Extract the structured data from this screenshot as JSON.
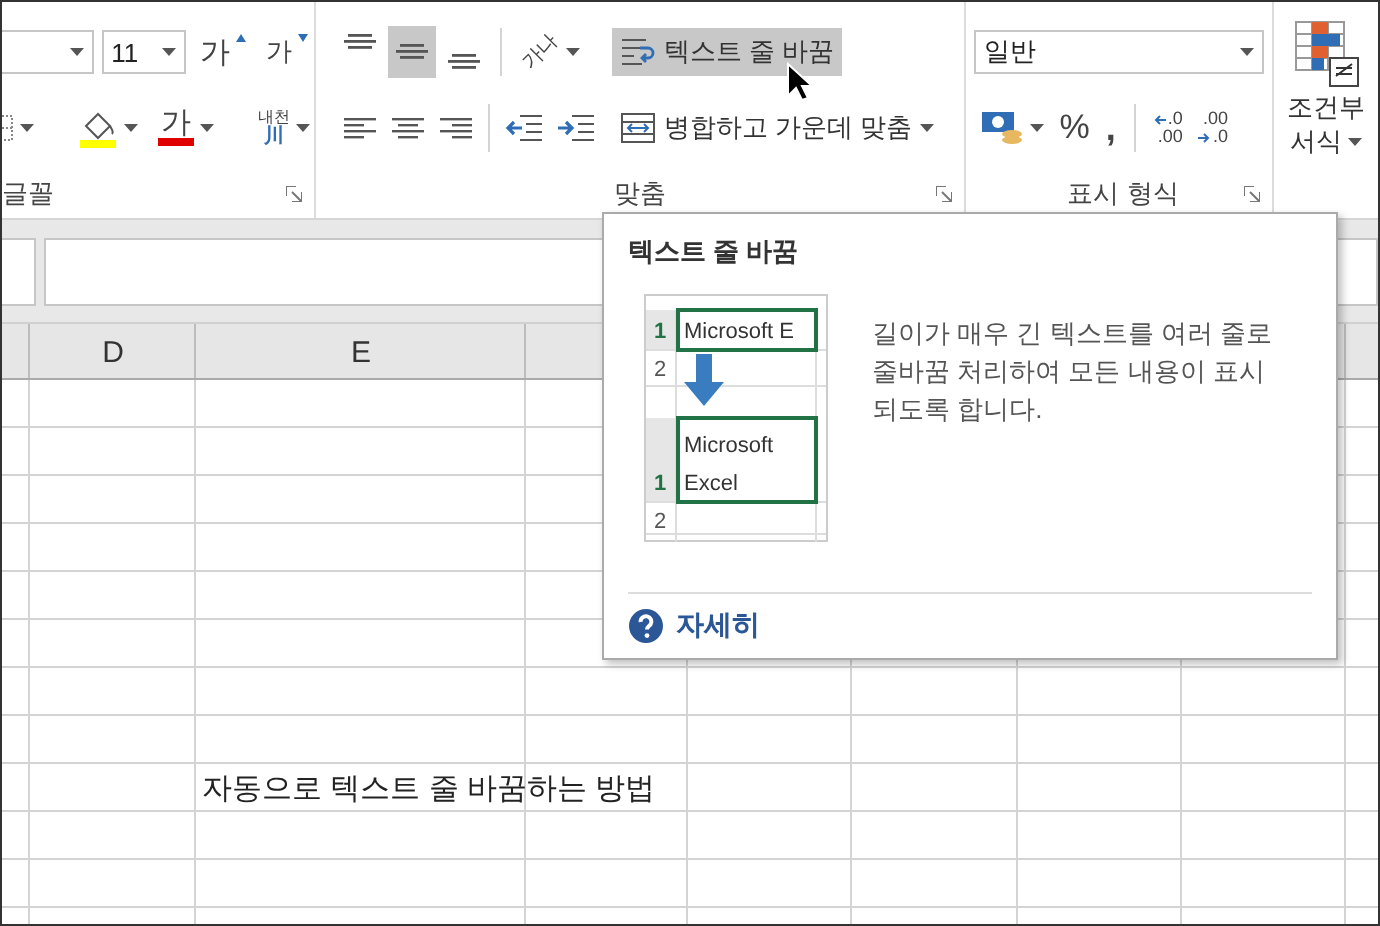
{
  "ribbon": {
    "font_size": "11",
    "grow_font": "가",
    "shrink_font": "가",
    "font_color_glyph": "가",
    "phonetic": [
      "내천",
      "川"
    ],
    "align_buttons": [
      {
        "kind": "top",
        "selected": false
      },
      {
        "kind": "middle",
        "selected": true
      },
      {
        "kind": "bottom",
        "selected": false
      }
    ],
    "orientation_glyph": "가나",
    "wrap_text": {
      "label": "텍스트 줄 바꿈",
      "selected": true
    },
    "merge": {
      "label": "병합하고 가운데 맞춤"
    },
    "number_format": {
      "value": "일반"
    },
    "percent": "%",
    "comma": ",",
    "decimal_buttons": [
      {
        "kind": "increase",
        "top": ".0",
        "bottom": ".00"
      },
      {
        "kind": "decrease",
        "top": ".00",
        "bottom": ".0"
      }
    ],
    "conditional_format": [
      "조건부",
      "서식"
    ],
    "groups": [
      {
        "label": "글꼴"
      },
      {
        "label": "맞춤"
      },
      {
        "label": "표시 형식"
      }
    ]
  },
  "sheet": {
    "columns": [
      "D",
      "E"
    ],
    "cells": [
      {
        "text": "자동으로 텍스트 줄 바꿈하는 방법"
      }
    ]
  },
  "tooltip": {
    "title": "텍스트 줄 바꿈",
    "description": "길이가 매우 긴 텍스트를 여러 줄로 줄바꿈 처리하여 모든 내용이 표시되도록 합니다.",
    "example": {
      "before_rows": [
        "1",
        "2"
      ],
      "before_text": "Microsoft E",
      "after_rows": [
        "1",
        "2"
      ],
      "after_lines": [
        "Microsoft",
        "Excel"
      ]
    },
    "link": "자세히"
  }
}
